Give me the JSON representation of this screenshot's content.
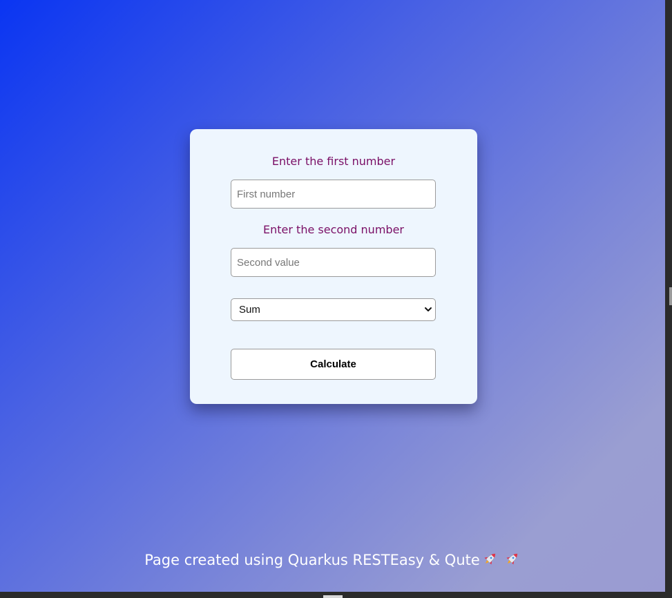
{
  "form": {
    "first_label": "Enter the first number",
    "first_placeholder": "First number",
    "second_label": "Enter the second number",
    "second_placeholder": "Second value",
    "operation_selected": "Sum",
    "calculate_label": "Calculate"
  },
  "footer": {
    "text": "Page created using Quarkus RESTEasy & Qute",
    "icons": [
      "rocket-icon",
      "rocket-icon"
    ]
  },
  "colors": {
    "label": "#7a0f66",
    "card_background": "#eef6fe",
    "gradient_start": "#0a35f2",
    "gradient_end": "#9a9bd2"
  }
}
